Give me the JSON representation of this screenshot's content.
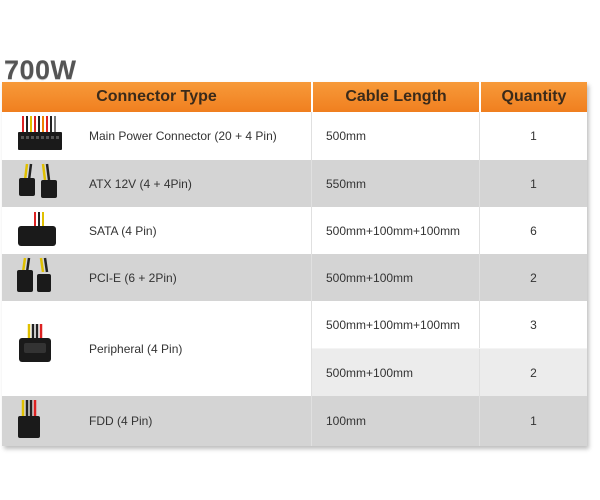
{
  "title": "700W",
  "headers": {
    "connector": "Connector Type",
    "length": "Cable Length",
    "quantity": "Quantity"
  },
  "rows": [
    {
      "name": "Main Power Connector (20 + 4 Pin)",
      "entries": [
        {
          "length": "500mm",
          "qty": "1"
        }
      ]
    },
    {
      "name": "ATX 12V (4 + 4Pin)",
      "entries": [
        {
          "length": "550mm",
          "qty": "1"
        }
      ]
    },
    {
      "name": "SATA (4 Pin)",
      "entries": [
        {
          "length": "500mm+100mm+100mm",
          "qty": "6"
        }
      ]
    },
    {
      "name": "PCI-E (6 + 2Pin)",
      "entries": [
        {
          "length": "500mm+100mm",
          "qty": "2"
        }
      ]
    },
    {
      "name": "Peripheral (4 Pin)",
      "entries": [
        {
          "length": "500mm+100mm+100mm",
          "qty": "3"
        },
        {
          "length": "500mm+100mm",
          "qty": "2"
        }
      ]
    },
    {
      "name": "FDD (4 Pin)",
      "entries": [
        {
          "length": "100mm",
          "qty": "1"
        }
      ]
    }
  ],
  "icons": [
    "atx-24pin-connector-icon",
    "atx-12v-connector-icon",
    "sata-connector-icon",
    "pcie-connector-icon",
    "molex-peripheral-connector-icon",
    "fdd-connector-icon"
  ]
}
